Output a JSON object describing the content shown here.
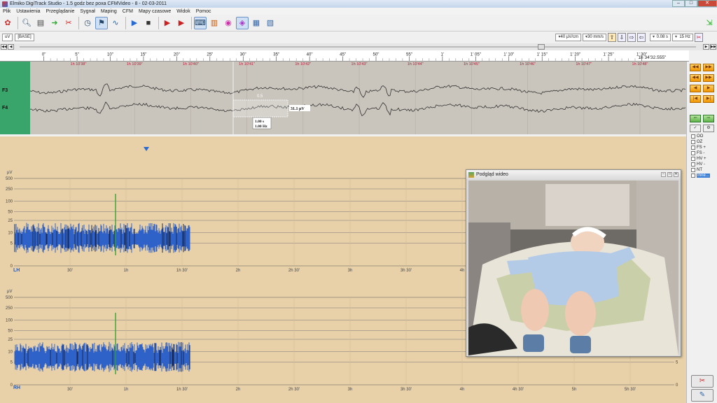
{
  "window": {
    "title": "Elmiko DigiTrack Studio - 1.5 godz bez poxa CFMVideo - 8 - 02-03-2011",
    "controls": [
      "–",
      "□",
      "✕"
    ]
  },
  "menu": [
    "Plik",
    "Ustawienia",
    "Przeglądanie",
    "Sygnał",
    "Maping",
    "CFM",
    "Mapy czasowe",
    "Widok",
    "Pomoc"
  ],
  "toolbar2": {
    "tab1": "uV",
    "tab2": "[BASE]",
    "sensitivity": "40 µV/cm",
    "speed": "30 mm/s",
    "time_constant": "0.08 s",
    "filter": "15 Hz"
  },
  "ruler": {
    "ticks": [
      "0\"",
      "5\"",
      "10\"",
      "15\"",
      "20\"",
      "25\"",
      "30\"",
      "35\"",
      "40\"",
      "45\"",
      "50\"",
      "55\"",
      "1’",
      "1’ 05\"",
      "1’ 10\"",
      "1’ 15\"",
      "1’ 20\"",
      "1’ 25\"",
      "1’ 30\""
    ],
    "end": "1h 34'32.555\""
  },
  "eeg": {
    "channels": [
      "F3",
      "F4"
    ],
    "time_marks": [
      "1h 10'38\"",
      "1h 10'39\"",
      "1h 10'40\"",
      "1h 10'41\"",
      "1h 10'42\"",
      "1h 10'43\"",
      "1h 10'44\"",
      "1h 10'45\"",
      "1h 10'46\"",
      "1h 10'47\"",
      "1h 10'48\""
    ],
    "measure_value": "0.5",
    "amplitude": "31.1 µV",
    "calibration": [
      "1.00 s",
      "1.00 Hz"
    ]
  },
  "tags": [
    "OO",
    "OZ",
    "FS +",
    "FS -",
    "HV +",
    "HV -",
    "NT",
    "Inne..."
  ],
  "spectra": [
    {
      "label": "LH",
      "unit": "µV",
      "y_ticks": [
        "500",
        "250",
        "100",
        "50",
        "25",
        "10",
        "5",
        "0"
      ],
      "x_ticks": [
        "30'",
        "1h",
        "1h 30'",
        "2h",
        "2h 30'",
        "3h",
        "3h 30'",
        "4h"
      ],
      "right_ticks": []
    },
    {
      "label": "RH",
      "unit": "µV",
      "y_ticks": [
        "500",
        "250",
        "100",
        "50",
        "25",
        "10",
        "5",
        "0"
      ],
      "x_ticks": [
        "30'",
        "1h",
        "1h 30'",
        "2h",
        "2h 30'",
        "3h",
        "3h 30'",
        "4h",
        "4h 30'",
        "5h",
        "5h 30'"
      ],
      "right_ticks": [
        "5",
        "0"
      ]
    }
  ],
  "video": {
    "title": "Podgląd wideo"
  }
}
